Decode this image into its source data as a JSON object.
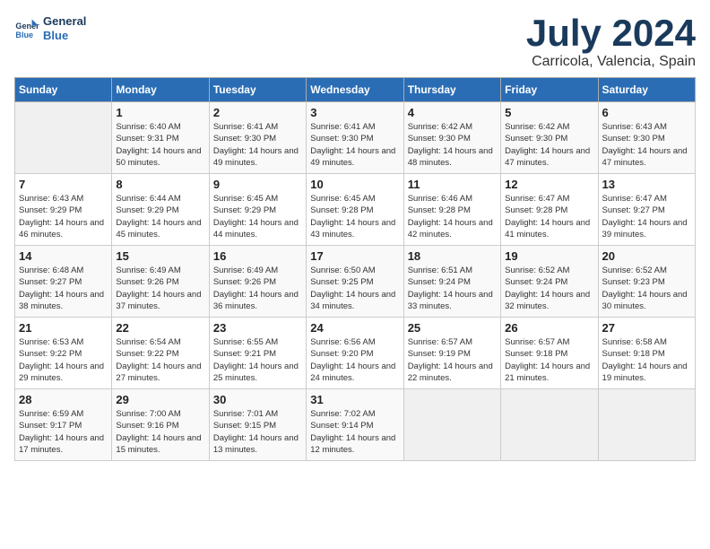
{
  "header": {
    "logo_line1": "General",
    "logo_line2": "Blue",
    "month": "July 2024",
    "location": "Carricola, Valencia, Spain"
  },
  "weekdays": [
    "Sunday",
    "Monday",
    "Tuesday",
    "Wednesday",
    "Thursday",
    "Friday",
    "Saturday"
  ],
  "weeks": [
    [
      {
        "day": "",
        "empty": true
      },
      {
        "day": "1",
        "sunrise": "6:40 AM",
        "sunset": "9:31 PM",
        "daylight": "14 hours and 50 minutes."
      },
      {
        "day": "2",
        "sunrise": "6:41 AM",
        "sunset": "9:30 PM",
        "daylight": "14 hours and 49 minutes."
      },
      {
        "day": "3",
        "sunrise": "6:41 AM",
        "sunset": "9:30 PM",
        "daylight": "14 hours and 49 minutes."
      },
      {
        "day": "4",
        "sunrise": "6:42 AM",
        "sunset": "9:30 PM",
        "daylight": "14 hours and 48 minutes."
      },
      {
        "day": "5",
        "sunrise": "6:42 AM",
        "sunset": "9:30 PM",
        "daylight": "14 hours and 47 minutes."
      },
      {
        "day": "6",
        "sunrise": "6:43 AM",
        "sunset": "9:30 PM",
        "daylight": "14 hours and 47 minutes."
      }
    ],
    [
      {
        "day": "7",
        "sunrise": "6:43 AM",
        "sunset": "9:29 PM",
        "daylight": "14 hours and 46 minutes."
      },
      {
        "day": "8",
        "sunrise": "6:44 AM",
        "sunset": "9:29 PM",
        "daylight": "14 hours and 45 minutes."
      },
      {
        "day": "9",
        "sunrise": "6:45 AM",
        "sunset": "9:29 PM",
        "daylight": "14 hours and 44 minutes."
      },
      {
        "day": "10",
        "sunrise": "6:45 AM",
        "sunset": "9:28 PM",
        "daylight": "14 hours and 43 minutes."
      },
      {
        "day": "11",
        "sunrise": "6:46 AM",
        "sunset": "9:28 PM",
        "daylight": "14 hours and 42 minutes."
      },
      {
        "day": "12",
        "sunrise": "6:47 AM",
        "sunset": "9:28 PM",
        "daylight": "14 hours and 41 minutes."
      },
      {
        "day": "13",
        "sunrise": "6:47 AM",
        "sunset": "9:27 PM",
        "daylight": "14 hours and 39 minutes."
      }
    ],
    [
      {
        "day": "14",
        "sunrise": "6:48 AM",
        "sunset": "9:27 PM",
        "daylight": "14 hours and 38 minutes."
      },
      {
        "day": "15",
        "sunrise": "6:49 AM",
        "sunset": "9:26 PM",
        "daylight": "14 hours and 37 minutes."
      },
      {
        "day": "16",
        "sunrise": "6:49 AM",
        "sunset": "9:26 PM",
        "daylight": "14 hours and 36 minutes."
      },
      {
        "day": "17",
        "sunrise": "6:50 AM",
        "sunset": "9:25 PM",
        "daylight": "14 hours and 34 minutes."
      },
      {
        "day": "18",
        "sunrise": "6:51 AM",
        "sunset": "9:24 PM",
        "daylight": "14 hours and 33 minutes."
      },
      {
        "day": "19",
        "sunrise": "6:52 AM",
        "sunset": "9:24 PM",
        "daylight": "14 hours and 32 minutes."
      },
      {
        "day": "20",
        "sunrise": "6:52 AM",
        "sunset": "9:23 PM",
        "daylight": "14 hours and 30 minutes."
      }
    ],
    [
      {
        "day": "21",
        "sunrise": "6:53 AM",
        "sunset": "9:22 PM",
        "daylight": "14 hours and 29 minutes."
      },
      {
        "day": "22",
        "sunrise": "6:54 AM",
        "sunset": "9:22 PM",
        "daylight": "14 hours and 27 minutes."
      },
      {
        "day": "23",
        "sunrise": "6:55 AM",
        "sunset": "9:21 PM",
        "daylight": "14 hours and 25 minutes."
      },
      {
        "day": "24",
        "sunrise": "6:56 AM",
        "sunset": "9:20 PM",
        "daylight": "14 hours and 24 minutes."
      },
      {
        "day": "25",
        "sunrise": "6:57 AM",
        "sunset": "9:19 PM",
        "daylight": "14 hours and 22 minutes."
      },
      {
        "day": "26",
        "sunrise": "6:57 AM",
        "sunset": "9:18 PM",
        "daylight": "14 hours and 21 minutes."
      },
      {
        "day": "27",
        "sunrise": "6:58 AM",
        "sunset": "9:18 PM",
        "daylight": "14 hours and 19 minutes."
      }
    ],
    [
      {
        "day": "28",
        "sunrise": "6:59 AM",
        "sunset": "9:17 PM",
        "daylight": "14 hours and 17 minutes."
      },
      {
        "day": "29",
        "sunrise": "7:00 AM",
        "sunset": "9:16 PM",
        "daylight": "14 hours and 15 minutes."
      },
      {
        "day": "30",
        "sunrise": "7:01 AM",
        "sunset": "9:15 PM",
        "daylight": "14 hours and 13 minutes."
      },
      {
        "day": "31",
        "sunrise": "7:02 AM",
        "sunset": "9:14 PM",
        "daylight": "14 hours and 12 minutes."
      },
      {
        "day": "",
        "empty": true
      },
      {
        "day": "",
        "empty": true
      },
      {
        "day": "",
        "empty": true
      }
    ]
  ]
}
